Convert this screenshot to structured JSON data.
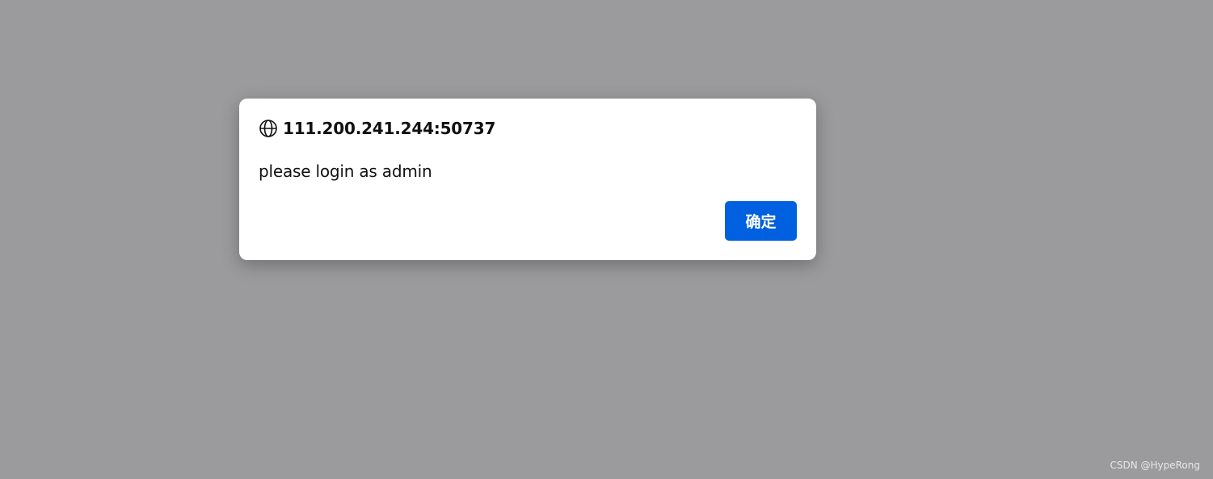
{
  "dialog": {
    "origin": "111.200.241.244:50737",
    "origin_icon": "globe-icon",
    "message": "please login as admin",
    "ok_label": "确定"
  },
  "watermark": "CSDN @HypeRong",
  "colors": {
    "backdrop": "#9b9b9d",
    "dialog_bg": "#ffffff",
    "button_bg": "#0060df",
    "button_text": "#ffffff",
    "text": "#111111"
  }
}
